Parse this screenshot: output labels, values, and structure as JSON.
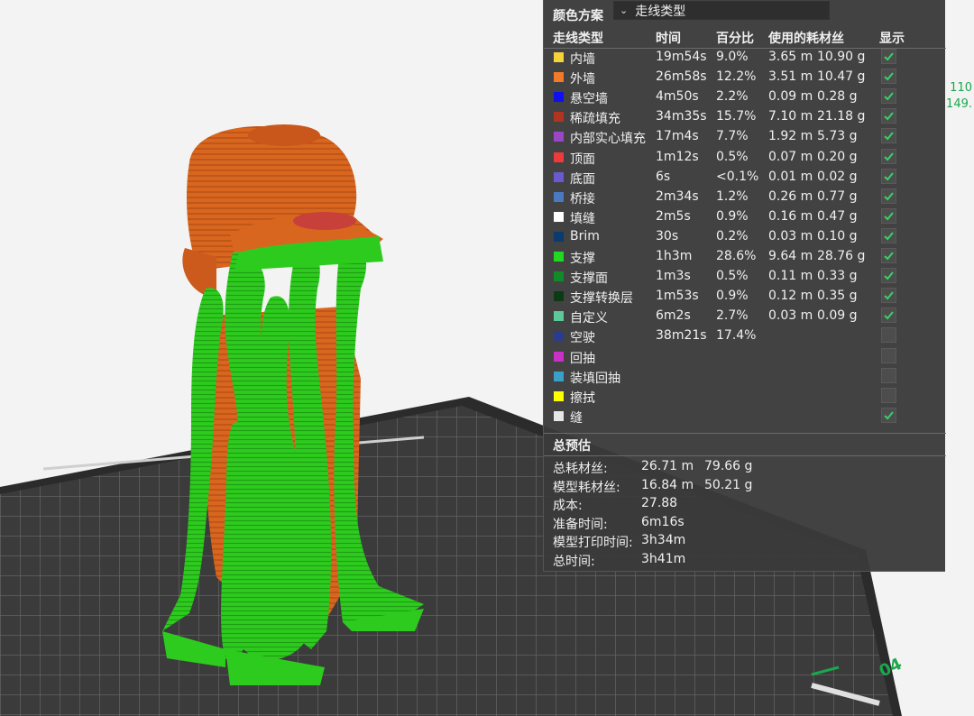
{
  "viewport": {
    "corner_values": [
      "110",
      "149."
    ],
    "bed_label": "04"
  },
  "panel": {
    "scheme_label": "颜色方案",
    "scheme_value": "走线类型",
    "headers": {
      "type": "走线类型",
      "time": "时间",
      "percent": "百分比",
      "filament": "使用的耗材丝",
      "show": "显示"
    },
    "rows": [
      {
        "name": "内墙",
        "color": "#f5d33b",
        "time": "19m54s",
        "percent": "9.0%",
        "length": "3.65 m",
        "weight": "10.90 g",
        "checked": true
      },
      {
        "name": "外墙",
        "color": "#f47a27",
        "time": "26m58s",
        "percent": "12.2%",
        "length": "3.51 m",
        "weight": "10.47 g",
        "checked": true
      },
      {
        "name": "悬空墙",
        "color": "#1010ee",
        "time": "4m50s",
        "percent": "2.2%",
        "length": "0.09 m",
        "weight": "0.28 g",
        "checked": true
      },
      {
        "name": "稀疏填充",
        "color": "#b0341f",
        "time": "34m35s",
        "percent": "15.7%",
        "length": "7.10 m",
        "weight": "21.18 g",
        "checked": true
      },
      {
        "name": "内部实心填充",
        "color": "#9a47c7",
        "time": "17m4s",
        "percent": "7.7%",
        "length": "1.92 m",
        "weight": "5.73 g",
        "checked": true
      },
      {
        "name": "顶面",
        "color": "#ee3a3a",
        "time": "1m12s",
        "percent": "0.5%",
        "length": "0.07 m",
        "weight": "0.20 g",
        "checked": true
      },
      {
        "name": "底面",
        "color": "#6a5ad0",
        "time": "6s",
        "percent": "<0.1%",
        "length": "0.01 m",
        "weight": "0.02 g",
        "checked": true
      },
      {
        "name": "桥接",
        "color": "#4a79c0",
        "time": "2m34s",
        "percent": "1.2%",
        "length": "0.26 m",
        "weight": "0.77 g",
        "checked": true
      },
      {
        "name": "填缝",
        "color": "#ffffff",
        "time": "2m5s",
        "percent": "0.9%",
        "length": "0.16 m",
        "weight": "0.47 g",
        "checked": true
      },
      {
        "name": "Brim",
        "color": "#0b3a6e",
        "time": "30s",
        "percent": "0.2%",
        "length": "0.03 m",
        "weight": "0.10 g",
        "checked": true
      },
      {
        "name": "支撑",
        "color": "#22d822",
        "time": "1h3m",
        "percent": "28.6%",
        "length": "9.64 m",
        "weight": "28.76 g",
        "checked": true
      },
      {
        "name": "支撑面",
        "color": "#138a2a",
        "time": "1m3s",
        "percent": "0.5%",
        "length": "0.11 m",
        "weight": "0.33 g",
        "checked": true
      },
      {
        "name": "支撑转换层",
        "color": "#0c3a14",
        "time": "1m53s",
        "percent": "0.9%",
        "length": "0.12 m",
        "weight": "0.35 g",
        "checked": true
      },
      {
        "name": "自定义",
        "color": "#5cc99a",
        "time": "6m2s",
        "percent": "2.7%",
        "length": "0.03 m",
        "weight": "0.09 g",
        "checked": true
      },
      {
        "name": "空驶",
        "color": "#2c3c8c",
        "time": "38m21s",
        "percent": "17.4%",
        "length": "",
        "weight": "",
        "checked": false
      },
      {
        "name": "回抽",
        "color": "#c830c8",
        "time": "",
        "percent": "",
        "length": "",
        "weight": "",
        "checked": false
      },
      {
        "name": "装填回抽",
        "color": "#3aa0c8",
        "time": "",
        "percent": "",
        "length": "",
        "weight": "",
        "checked": false
      },
      {
        "name": "擦拭",
        "color": "#ffff00",
        "time": "",
        "percent": "",
        "length": "",
        "weight": "",
        "checked": false
      },
      {
        "name": "缝",
        "color": "#e6e6e6",
        "time": "",
        "percent": "",
        "length": "",
        "weight": "",
        "checked": true
      }
    ],
    "estimate": {
      "title": "总预估",
      "rows": [
        {
          "label": "总耗材丝:",
          "v1": "26.71 m",
          "v2": "79.66 g"
        },
        {
          "label": "模型耗材丝:",
          "v1": "16.84 m",
          "v2": "50.21 g"
        },
        {
          "label": "成本:",
          "v1": "27.88",
          "v2": ""
        },
        {
          "label": "准备时间:",
          "v1": "6m16s",
          "v2": ""
        },
        {
          "label": "模型打印时间:",
          "v1": "3h34m",
          "v2": ""
        },
        {
          "label": "总时间:",
          "v1": "3h41m",
          "v2": ""
        }
      ]
    }
  }
}
